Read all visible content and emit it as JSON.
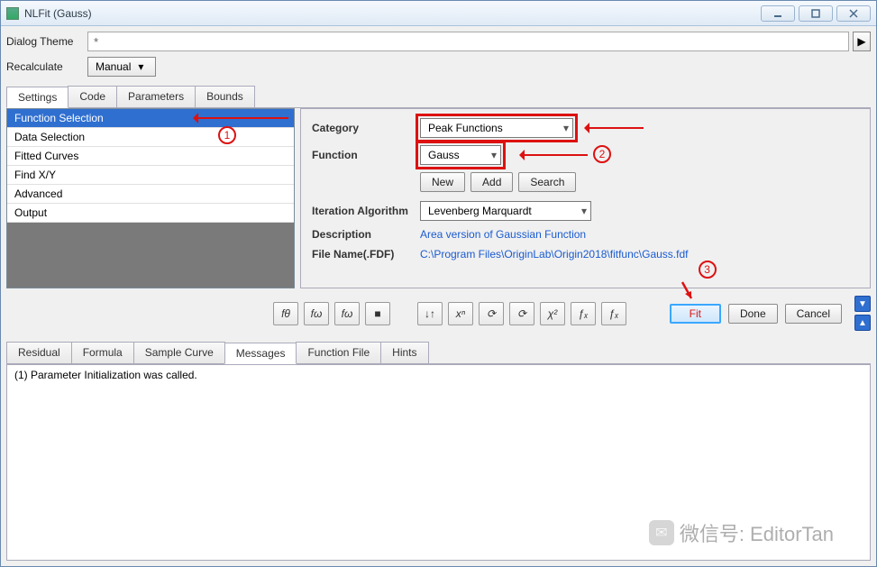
{
  "window": {
    "title": "NLFit (Gauss)"
  },
  "dialogTheme": {
    "label": "Dialog Theme",
    "value": "*"
  },
  "recalculate": {
    "label": "Recalculate",
    "value": "Manual"
  },
  "topTabs": [
    "Settings",
    "Code",
    "Parameters",
    "Bounds"
  ],
  "topTabActive": 0,
  "leftList": [
    "Function Selection",
    "Data Selection",
    "Fitted Curves",
    "Find X/Y",
    "Advanced",
    "Output"
  ],
  "leftListSelected": 0,
  "form": {
    "category": {
      "label": "Category",
      "value": "Peak Functions"
    },
    "function": {
      "label": "Function",
      "value": "Gauss"
    },
    "buttons": {
      "new": "New",
      "add": "Add",
      "search": "Search"
    },
    "iterAlg": {
      "label": "Iteration Algorithm",
      "value": "Levenberg Marquardt"
    },
    "description": {
      "label": "Description",
      "value": "Area version of Gaussian Function"
    },
    "fileName": {
      "label": "File Name(.FDF)",
      "value": "C:\\Program Files\\OriginLab\\Origin2018\\fitfunc\\Gauss.fdf"
    }
  },
  "toolIcons": [
    "fθ",
    "fω",
    "fω",
    "■",
    "↓↑",
    "xⁿ",
    "⟳",
    "⟳",
    "χ²",
    "ƒₓ",
    "ƒₓ"
  ],
  "endButtons": {
    "fit": "Fit",
    "done": "Done",
    "cancel": "Cancel"
  },
  "bottomTabs": [
    "Residual",
    "Formula",
    "Sample Curve",
    "Messages",
    "Function File",
    "Hints"
  ],
  "bottomTabActive": 3,
  "messages": "(1) Parameter Initialization was called.",
  "annotations": {
    "n1": "1",
    "n2": "2",
    "n3": "3"
  },
  "watermark": "微信号: EditorTan"
}
